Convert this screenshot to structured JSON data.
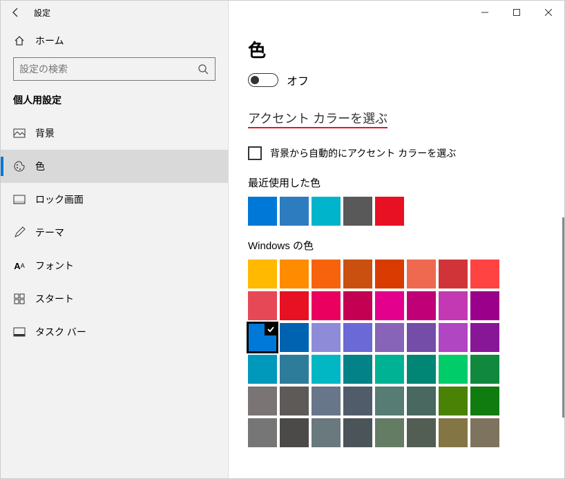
{
  "titlebar": {
    "title": "設定"
  },
  "home_label": "ホーム",
  "search": {
    "placeholder": "設定の検索"
  },
  "section_title": "個人用設定",
  "nav": [
    {
      "label": "背景"
    },
    {
      "label": "色"
    },
    {
      "label": "ロック画面"
    },
    {
      "label": "テーマ"
    },
    {
      "label": "フォント"
    },
    {
      "label": "スタート"
    },
    {
      "label": "タスク バー"
    }
  ],
  "page": {
    "h1": "色",
    "toggle_label": "オフ",
    "h2": "アクセント カラーを選ぶ",
    "checkbox_label": "背景から自動的にアクセント カラーを選ぶ",
    "recent_label": "最近使用した色",
    "windows_label": "Windows の色"
  },
  "recent_colors": [
    "#0078d7",
    "#2e7cc0",
    "#00b4cc",
    "#595959",
    "#e81123"
  ],
  "windows_colors": [
    "#ffb900",
    "#ff8c00",
    "#f7630c",
    "#ca5010",
    "#da3b01",
    "#ef6950",
    "#d13438",
    "#ff4343",
    "#e74856",
    "#e81123",
    "#ea005e",
    "#c30052",
    "#e3008c",
    "#bf0077",
    "#c239b3",
    "#9a0089",
    "#0078d7",
    "#0063b1",
    "#8e8cd8",
    "#6b69d6",
    "#8764b8",
    "#744da9",
    "#b146c2",
    "#881798",
    "#0099bc",
    "#2d7d9a",
    "#00b7c3",
    "#038387",
    "#00b294",
    "#018574",
    "#00cc6a",
    "#10893e",
    "#7a7574",
    "#5d5a58",
    "#68768a",
    "#515c6b",
    "#567c73",
    "#486860",
    "#498205",
    "#107c10",
    "#767676",
    "#4c4a48",
    "#69797e",
    "#4a5459",
    "#647c64",
    "#525e54",
    "#847545",
    "#7e735f"
  ],
  "selected_index": 16
}
